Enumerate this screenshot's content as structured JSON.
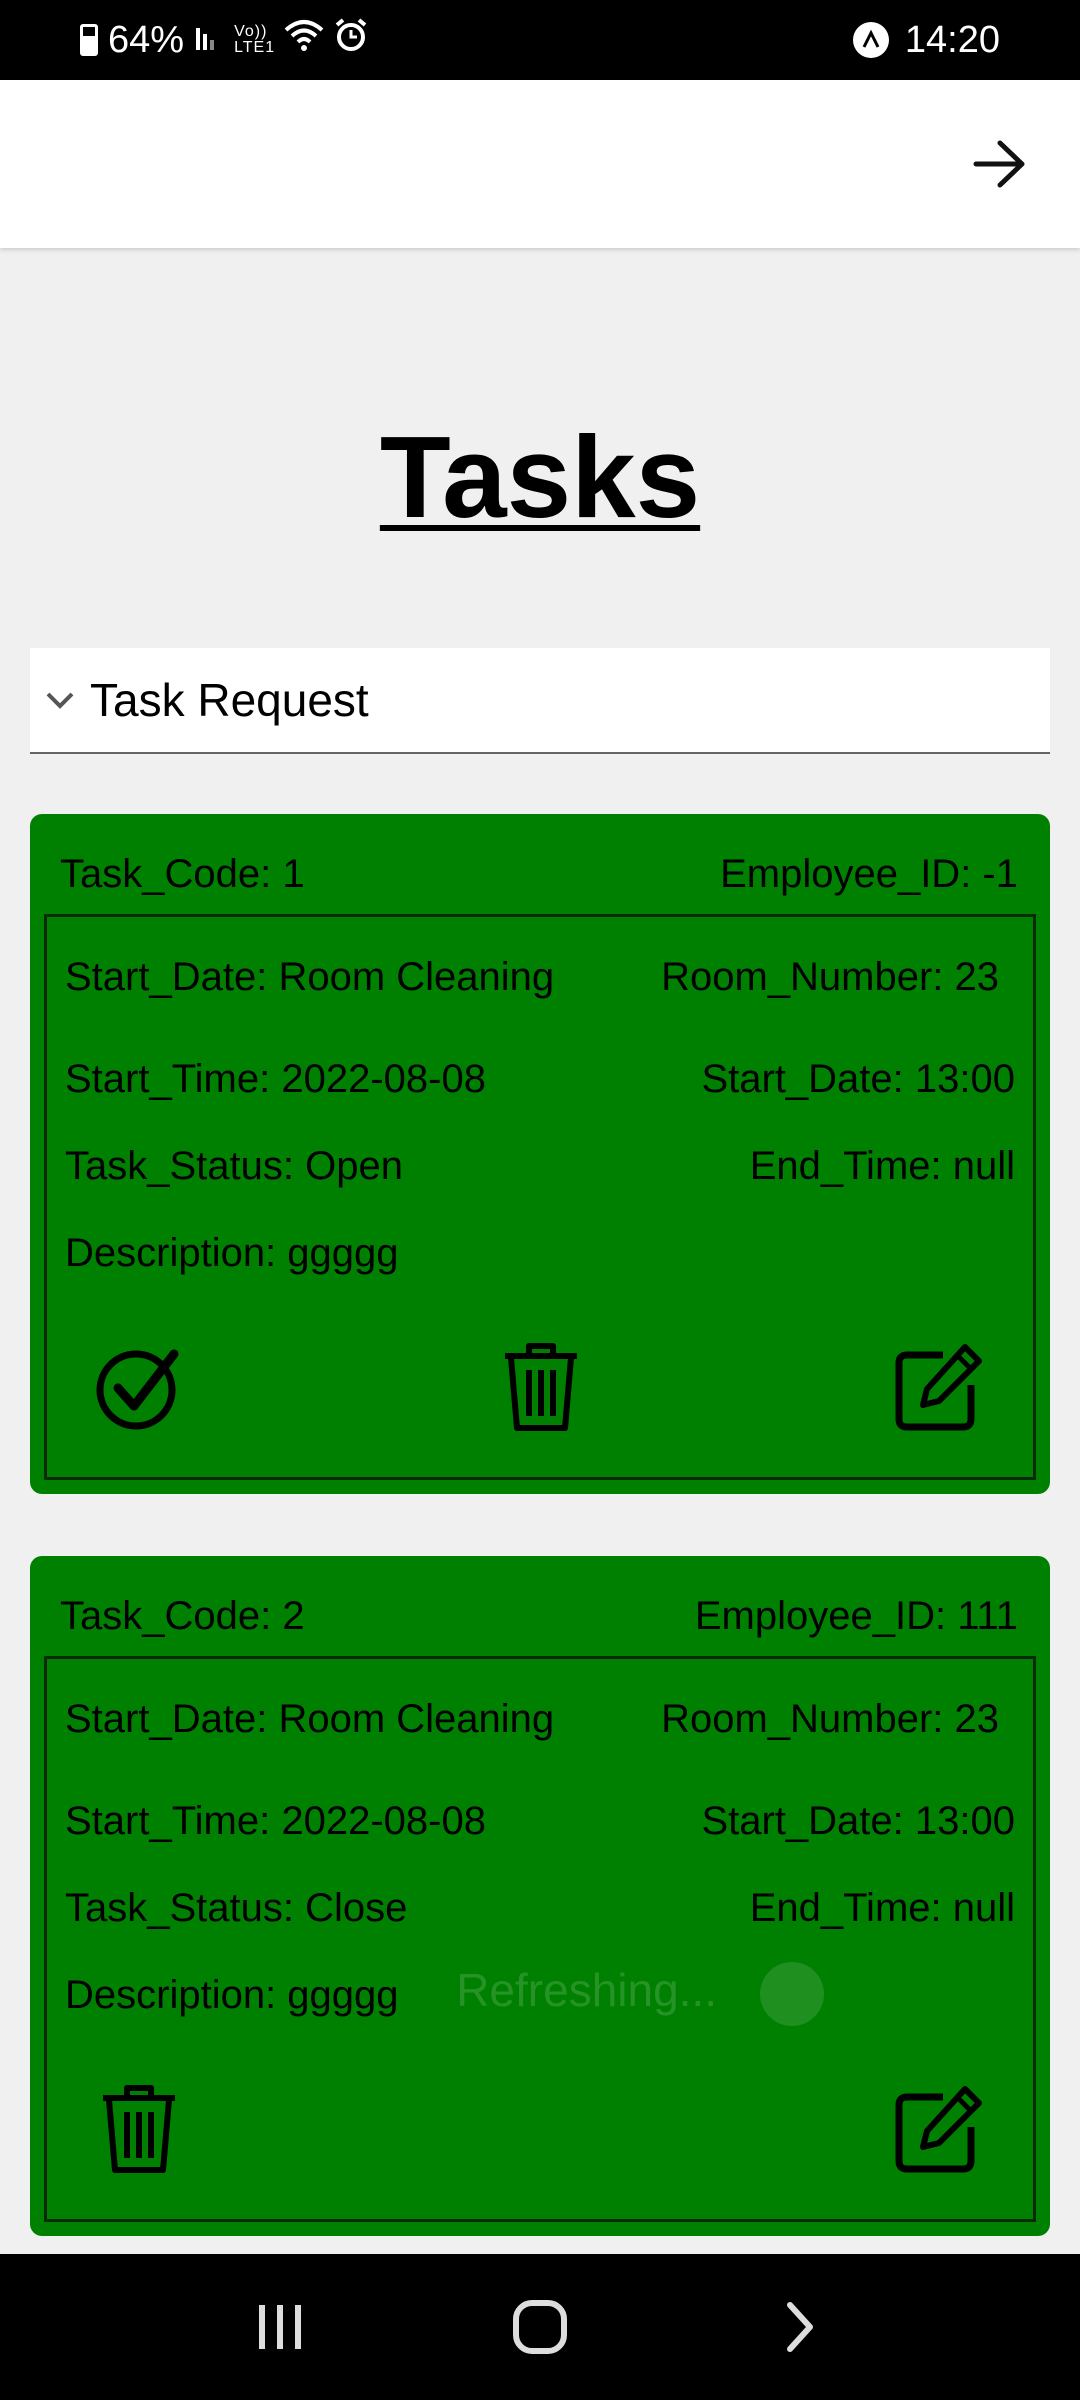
{
  "status_bar": {
    "battery": "64%",
    "time": "14:20",
    "volte": "Vo)) LTE1"
  },
  "app_bar": {
    "forward_icon": "arrow-right-icon"
  },
  "title": "Tasks",
  "accordion": {
    "label": "Task Request",
    "icon": "chevron-down-icon"
  },
  "tasks": [
    {
      "task_code": "Task_Code: 1",
      "employee_id": "Employee_ID: -1",
      "row1_left": "Start_Date: Room Cleaning",
      "row1_right": "Room_Number: 23",
      "row2_left": "Start_Time: 2022-08-08",
      "row2_right": "Start_Date: 13:00",
      "row3_left": "Task_Status: Open",
      "row3_right": "End_Time: null",
      "description": "Description: ggggg",
      "actions": [
        "check-circle-icon",
        "trash-icon",
        "edit-icon"
      ]
    },
    {
      "task_code": "Task_Code: 2",
      "employee_id": "Employee_ID: 111",
      "row1_left": "Start_Date: Room Cleaning",
      "row1_right": "Room_Number: 23",
      "row2_left": "Start_Time: 2022-08-08",
      "row2_right": "Start_Date: 13:00",
      "row3_left": "Task_Status: Close",
      "row3_right": "End_Time: null",
      "description": "Description: ggggg",
      "actions": [
        "trash-icon",
        "edit-icon"
      ]
    }
  ],
  "refresh_text": "Refreshing...",
  "nav": {
    "recent": "recent-apps-icon",
    "home": "home-icon",
    "back": "back-icon"
  },
  "colors": {
    "card_bg": "#008000",
    "page_bg": "#f0f0f0"
  }
}
